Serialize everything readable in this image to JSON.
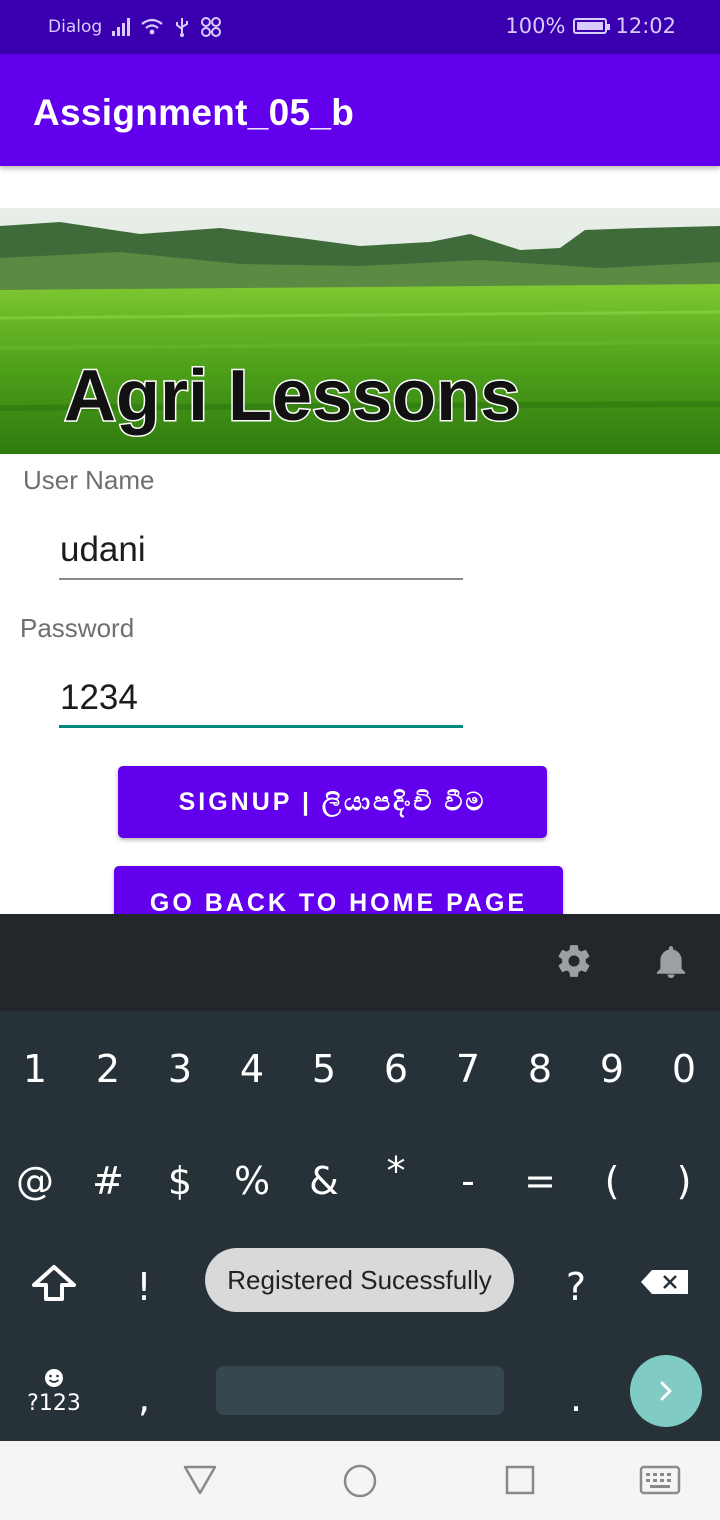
{
  "status_bar": {
    "carrier": "Dialog",
    "battery": "100%",
    "time": "12:02"
  },
  "app_bar": {
    "title": "Assignment_05_b"
  },
  "banner": {
    "text": "Agri Lessons"
  },
  "form": {
    "username_label": "User Name",
    "username_value": "udani",
    "password_label": "Password",
    "password_value": "1234"
  },
  "buttons": {
    "signup": "SIGNUP | ලියාපදිංචි වීම",
    "home": "GO BACK TO HOME PAGE"
  },
  "keyboard": {
    "row1": [
      "1",
      "2",
      "3",
      "4",
      "5",
      "6",
      "7",
      "8",
      "9",
      "0"
    ],
    "row2": [
      "@",
      "#",
      "$",
      "%",
      "&",
      "*",
      "-",
      "=",
      "(",
      ")"
    ],
    "row3": [
      "!",
      "?"
    ],
    "symbols_key": "?123",
    "comma": ",",
    "period": "."
  },
  "toast": "Registered Sucessfully",
  "icons": {
    "settings": "gear-icon",
    "notification": "bell-icon",
    "shift": "shift-icon",
    "delete": "backspace-icon",
    "enter": "chevron-right-icon",
    "emoji": "emoji-icon",
    "nav_back": "triangle-back-icon",
    "nav_home": "circle-home-icon",
    "nav_recent": "square-recent-icon",
    "nav_keyboard": "keyboard-icon"
  },
  "colors": {
    "primary": "#6200ee",
    "status_bar": "#3a00b0",
    "accent": "#00897b",
    "keyboard_bg": "#263238",
    "enter_key": "#80cbc4"
  }
}
